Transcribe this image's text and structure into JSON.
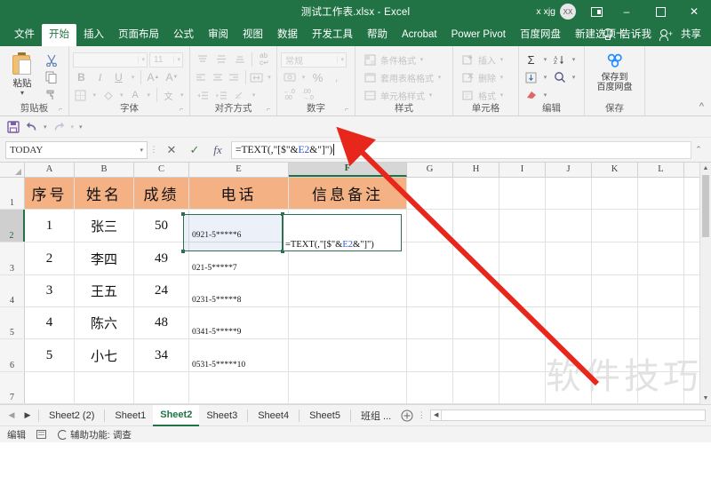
{
  "titlebar": {
    "document_title": "测试工作表.xlsx  -  Excel",
    "account_name": "x xjg",
    "avatar_initials": "XX",
    "ribbon_display_options": "ribbon-display-options",
    "minimize": "–",
    "maximize": "☐",
    "close": "✕"
  },
  "menubar": {
    "tabs": [
      {
        "label": "文件",
        "active": false
      },
      {
        "label": "开始",
        "active": true
      },
      {
        "label": "插入",
        "active": false
      },
      {
        "label": "页面布局",
        "active": false
      },
      {
        "label": "公式",
        "active": false
      },
      {
        "label": "审阅",
        "active": false
      },
      {
        "label": "视图",
        "active": false
      },
      {
        "label": "数据",
        "active": false
      },
      {
        "label": "开发工具",
        "active": false
      },
      {
        "label": "帮助",
        "active": false
      },
      {
        "label": "Acrobat",
        "active": false
      },
      {
        "label": "Power Pivot",
        "active": false
      },
      {
        "label": "百度网盘",
        "active": false
      },
      {
        "label": "新建选项卡",
        "active": false
      }
    ],
    "tell_me": "告诉我",
    "share": "共享"
  },
  "ribbon": {
    "groups": [
      {
        "name": "剪贴板"
      },
      {
        "name": "字体"
      },
      {
        "name": "对齐方式"
      },
      {
        "name": "数字"
      },
      {
        "name": "样式"
      },
      {
        "name": "单元格"
      },
      {
        "name": "编辑"
      },
      {
        "name": "保存"
      }
    ],
    "clipboard": {
      "paste_label": "粘贴",
      "cut": "✂",
      "copy": "copy",
      "format_painter": "format-painter"
    },
    "font": {
      "font_name_value": "",
      "font_size_value": "11",
      "bold": "B",
      "italic": "I",
      "underline": "U",
      "grow_font": "A",
      "shrink_font": "A",
      "borders": "borders",
      "fill_color": "fill",
      "font_color": "A",
      "phonetic": "文"
    },
    "number": {
      "format_value": "常规",
      "percent": "%",
      "comma": ",",
      "inc_decimal": "inc",
      "dec_decimal": "dec"
    },
    "styles": {
      "conditional": "条件格式",
      "table_styles": "套用表格格式",
      "cell_styles": "单元格样式"
    },
    "cells": {
      "insert": "插入",
      "delete": "删除",
      "format": "格式"
    },
    "editing": {
      "autosum": "Σ",
      "sort_filter": "sort-filter",
      "fill": "fill-down",
      "find": "find",
      "clear": "clear"
    },
    "save": {
      "line1": "保存到",
      "line2": "百度网盘"
    },
    "collapse": "^"
  },
  "qat": {
    "save": "save",
    "undo": "undo",
    "redo": "redo",
    "customize": "customize"
  },
  "formula_bar": {
    "name_box_value": "TODAY",
    "cancel": "✕",
    "enter": "✓",
    "insert_function": "fx",
    "formula_prefix": "=TEXT(,\"[$\"&",
    "formula_ref": "E2",
    "formula_suffix": "&\"]\")",
    "formula_full": "=TEXT(,\"[$\"&E2&\"]\")",
    "expand": "⌃"
  },
  "grid": {
    "columns": [
      "A",
      "B",
      "C",
      "E",
      "F",
      "G",
      "H",
      "I",
      "J",
      "K",
      "L"
    ],
    "selected_column": "F",
    "rows": [
      "1",
      "2",
      "3",
      "4",
      "5",
      "6",
      "7"
    ],
    "selected_row": "2",
    "header_row": [
      "序号",
      "姓名",
      "成绩",
      "电话",
      "信息备注"
    ],
    "header_fill": "#f4b183",
    "data_rows": [
      {
        "序号": "1",
        "姓名": "张三",
        "成绩": "50",
        "电话": "0921-5*****6",
        "信息备注": ""
      },
      {
        "序号": "2",
        "姓名": "李四",
        "成绩": "49",
        "电话": "021-5*****7",
        "信息备注": ""
      },
      {
        "序号": "3",
        "姓名": "王五",
        "成绩": "24",
        "电话": "0231-5*****8",
        "信息备注": ""
      },
      {
        "序号": "4",
        "姓名": "陈六",
        "成绩": "48",
        "电话": "0341-5*****9",
        "信息备注": ""
      },
      {
        "序号": "5",
        "姓名": "小七",
        "成绩": "34",
        "电话": "0531-5*****10",
        "信息备注": ""
      }
    ],
    "editing_cell": "F2",
    "editing_text_prefix": "=TEXT(,\"[$\"&",
    "editing_text_ref": "E2",
    "editing_text_suffix": "&\"]\")",
    "selected_ref_cell": "E2",
    "watermark": "软件技巧"
  },
  "sheet_tabs": {
    "first": "◀",
    "prev": "◀",
    "next": "▶",
    "last": "▶",
    "tabs": [
      {
        "label": "Sheet2 (2)",
        "active": false
      },
      {
        "label": "Sheet1",
        "active": false
      },
      {
        "label": "Sheet2",
        "active": true
      },
      {
        "label": "Sheet3",
        "active": false
      },
      {
        "label": "Sheet4",
        "active": false
      },
      {
        "label": "Sheet5",
        "active": false
      },
      {
        "label": "班组 ...",
        "active": false
      }
    ],
    "add_sheet": "+",
    "more": "⋮"
  },
  "statusbar": {
    "mode": "编辑",
    "macro_record": "record-macro",
    "accessibility": "辅助功能: 调查"
  },
  "colors": {
    "excel_green": "#217346",
    "header_orange": "#f4b183",
    "selection_green": "#2f6e53",
    "annotation_red": "#e8271c",
    "ref_blue": "#3355cc"
  }
}
